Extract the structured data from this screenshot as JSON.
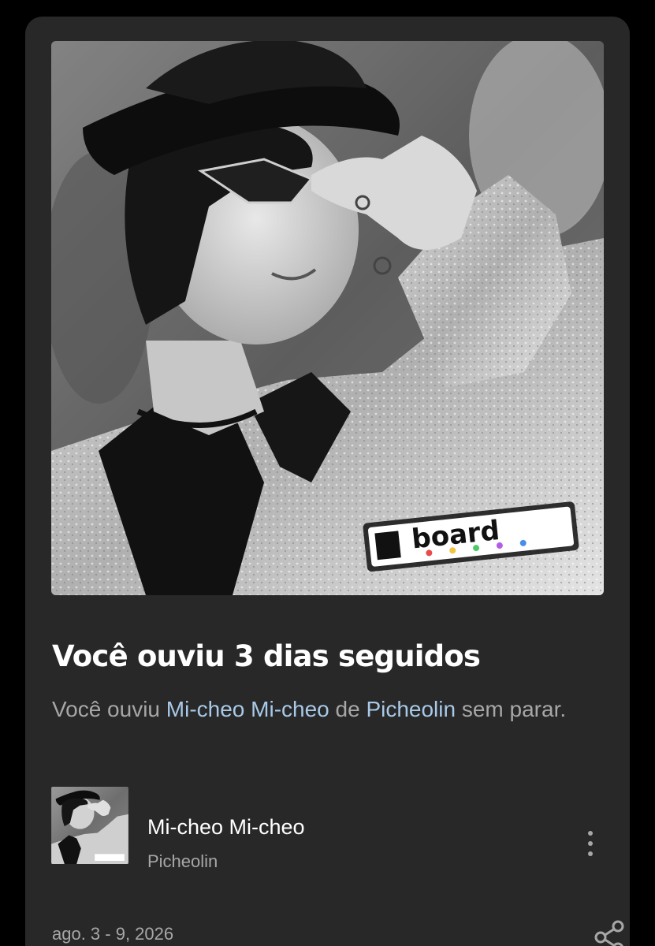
{
  "card": {
    "cover_alt": "Album cover photo",
    "cover_logo_text": "board",
    "headline": "Você ouviu 3 dias seguidos",
    "description": {
      "prefix": "Você ouviu ",
      "song": "Mi-cheo Mi-cheo",
      "middle": " de ",
      "artist": "Picheolin",
      "suffix": " sem parar."
    },
    "track": {
      "title": "Mi-cheo Mi-cheo",
      "artist": "Picheolin",
      "more_icon": "more-vertical-icon"
    },
    "date_range": "ago. 3 - 9, 2026",
    "share_icon": "share-icon"
  },
  "colors": {
    "background": "#000000",
    "card": "#282828",
    "primary_text": "#ffffff",
    "secondary_text": "#a7a7a7",
    "link_text": "#a8c9e8"
  }
}
